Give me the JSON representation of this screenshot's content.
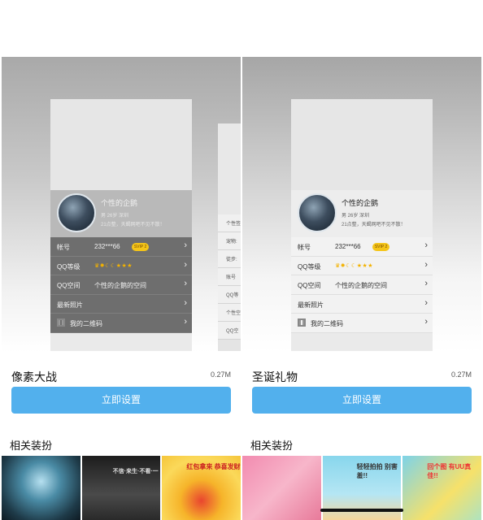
{
  "panels": [
    {
      "item_name": "像素大战",
      "item_size": "0.27M",
      "set_button": "立即设置",
      "related_title": "相关装扮",
      "profile": {
        "nickname": "个性的企鹅",
        "info": "男 26岁 深圳",
        "signature": "21点整，天蝎网吧不见不散！"
      },
      "rows": {
        "account_label": "帐号",
        "account_value": "232***66",
        "svip": "SVIP 2",
        "level_label": "QQ等级",
        "level_value": "♛✹☾☾★★★",
        "space_label": "QQ空间",
        "space_value": "个性的企鹅的空间",
        "photos_label": "最新照片",
        "qrcode_label": "我的二维码"
      },
      "ghost": [
        "个性签",
        "宠物:",
        "徒步:",
        "账号",
        "QQ等",
        "个性空",
        "QQ空"
      ],
      "thumbs": [
        "",
        "不信·来生·不看·一",
        "红包拿来 恭喜发财"
      ]
    },
    {
      "item_name": "圣诞礼物",
      "item_size": "0.27M",
      "set_button": "立即设置",
      "related_title": "相关装扮",
      "profile": {
        "nickname": "个性的企鹅",
        "info": "男 26岁 深圳",
        "signature": "21点整，天蝎网吧不见不散！"
      },
      "rows": {
        "account_label": "帐号",
        "account_value": "232***66",
        "svip": "SVIP 2",
        "level_label": "QQ等级",
        "level_value": "♛✹☾☾★★★",
        "space_label": "QQ空间",
        "space_value": "个性的企鹅的空间",
        "photos_label": "最新照片",
        "qrcode_label": "我的二维码"
      },
      "thumbs": [
        "",
        "轻轻拍拍 别害羞!!",
        "回个图 有UU真佳!!"
      ]
    }
  ],
  "icons": {
    "chevron": "chevron-right-icon",
    "qr": "qr-code-icon",
    "vip": "svip-badge-icon"
  }
}
